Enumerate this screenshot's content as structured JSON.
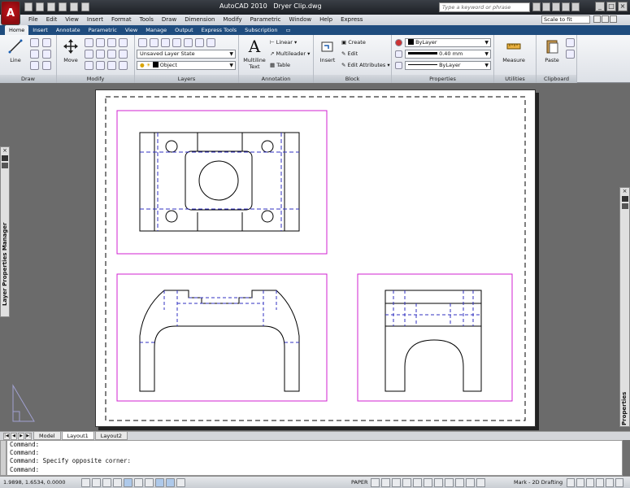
{
  "app": {
    "title": "AutoCAD 2010",
    "file": "Dryer Clip.dwg",
    "logo": "A"
  },
  "search": {
    "placeholder": "Type a keyword or phrase"
  },
  "menu": [
    "File",
    "Edit",
    "View",
    "Insert",
    "Format",
    "Tools",
    "Draw",
    "Dimension",
    "Modify",
    "Parametric",
    "Window",
    "Help",
    "Express"
  ],
  "scale": "Scale to fit",
  "tabs": [
    "Home",
    "Insert",
    "Annotate",
    "Parametric",
    "View",
    "Manage",
    "Output",
    "Express Tools",
    "Subscription"
  ],
  "ribbon": {
    "draw": {
      "title": "Draw",
      "line": "Line"
    },
    "modify": {
      "title": "Modify",
      "move": "Move"
    },
    "layers": {
      "title": "Layers",
      "state": "Unsaved Layer State",
      "layer": "Object"
    },
    "annotation": {
      "title": "Annotation",
      "mtext": "Multiline",
      "mtext2": "Text",
      "linear": "Linear",
      "multileader": "Multileader",
      "table": "Table"
    },
    "block": {
      "title": "Block",
      "insert": "Insert",
      "create": "Create",
      "edit": "Edit",
      "editattr": "Edit Attributes"
    },
    "properties": {
      "title": "Properties",
      "color": "ByLayer",
      "lineweight": "0.40 mm",
      "linetype": "ByLayer"
    },
    "utilities": {
      "title": "Utilities",
      "measure": "Measure"
    },
    "clipboard": {
      "title": "Clipboard",
      "paste": "Paste"
    }
  },
  "palettes": {
    "left": "Layer Properties Manager",
    "right": "Properties"
  },
  "layout_tabs": [
    "Model",
    "Layout1",
    "Layout2"
  ],
  "command_lines": [
    "Command:",
    "Command:",
    "Command: Specify opposite corner:",
    "Command:"
  ],
  "status": {
    "coords": "1.9898, 1.6534, 0.0000",
    "space": "PAPER",
    "workspace": "Mark - 2D Drafting"
  }
}
